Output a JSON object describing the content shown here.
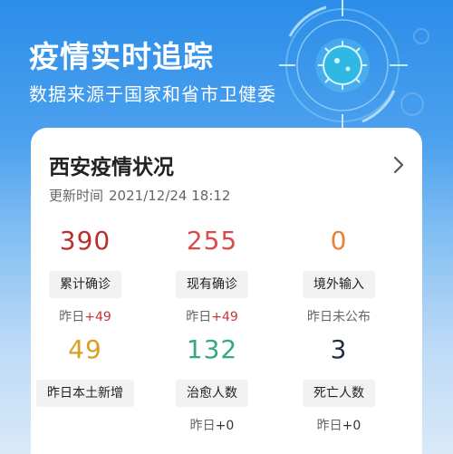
{
  "header": {
    "title": "疫情实时追踪",
    "subtitle": "数据来源于国家和省市卫健委"
  },
  "card": {
    "title": "西安疫情状况",
    "update_label": "更新时间",
    "update_time": "2021/12/24 18:12"
  },
  "stats": [
    {
      "value": "390",
      "label": "累计确诊",
      "delta_prefix": "昨日",
      "delta_value": "+49",
      "color": "#b8302f"
    },
    {
      "value": "255",
      "label": "现有确诊",
      "delta_prefix": "昨日",
      "delta_value": "+49",
      "color": "#d94b4b"
    },
    {
      "value": "0",
      "label": "境外输入",
      "delta_prefix": "昨日未公布",
      "delta_value": "",
      "color": "#e6813a"
    },
    {
      "value": "49",
      "label": "昨日本土新增",
      "delta_prefix": "",
      "delta_value": "",
      "color": "#d9a026"
    },
    {
      "value": "132",
      "label": "治愈人数",
      "delta_prefix": "昨日",
      "delta_value": "+0",
      "color": "#33a887"
    },
    {
      "value": "3",
      "label": "死亡人数",
      "delta_prefix": "昨日",
      "delta_value": "+0",
      "color": "#1f2f44"
    }
  ]
}
